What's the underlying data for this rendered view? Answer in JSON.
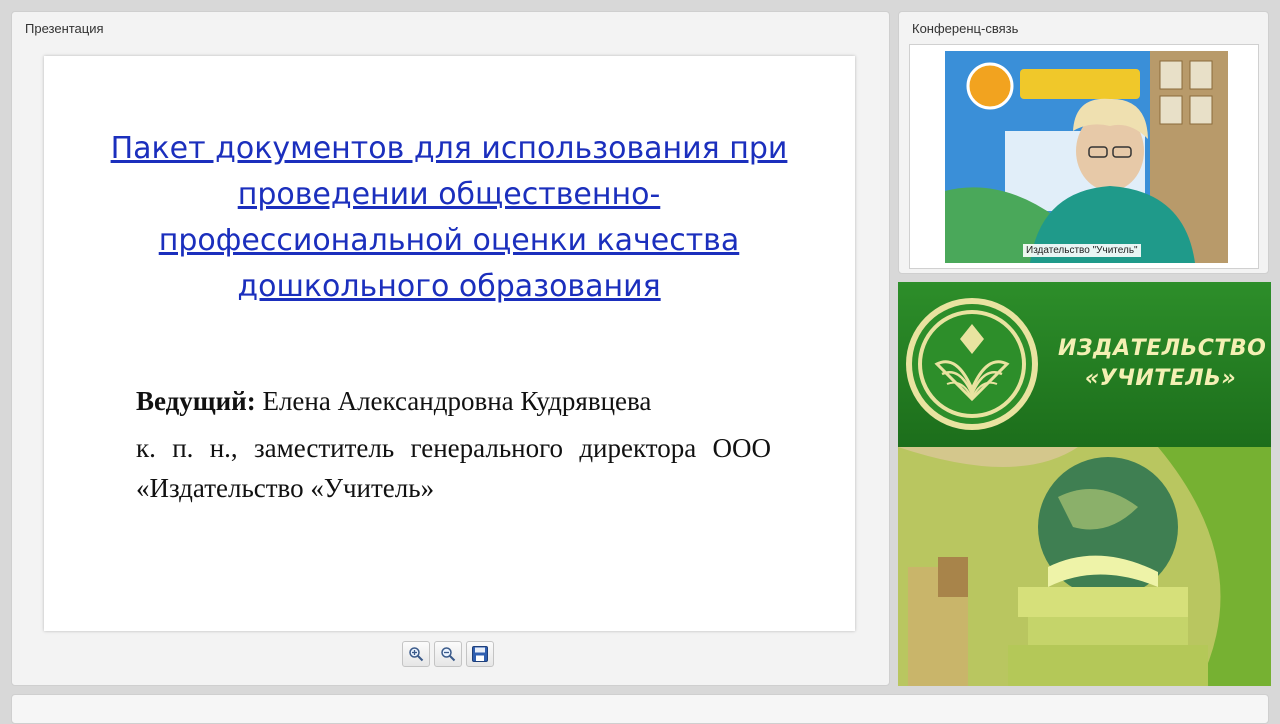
{
  "presentation_panel": {
    "title": "Презентация",
    "slide": {
      "title": "Пакет документов для использования при проведении общественно-профессиональной оценки качества дошкольного образования",
      "presenter_label": "Ведущий:",
      "presenter_name": "Елена Александровна Кудрявцева",
      "affiliation": "к. п. н., заместитель генерального директора ООО «Издательство «Учитель»"
    },
    "toolbar": {
      "zoom_in_icon": "zoom-in-icon",
      "zoom_out_icon": "zoom-out-icon",
      "save_icon": "save-icon"
    }
  },
  "conference_panel": {
    "title": "Конференц-связь",
    "video_caption": "Издательство \"Учитель\""
  },
  "banner": {
    "publisher_name": "ИЗДАТЕЛЬСТВО «УЧИТЕЛЬ»",
    "colors": {
      "green": "#2d8e2a",
      "text": "#f4f0b4"
    }
  }
}
